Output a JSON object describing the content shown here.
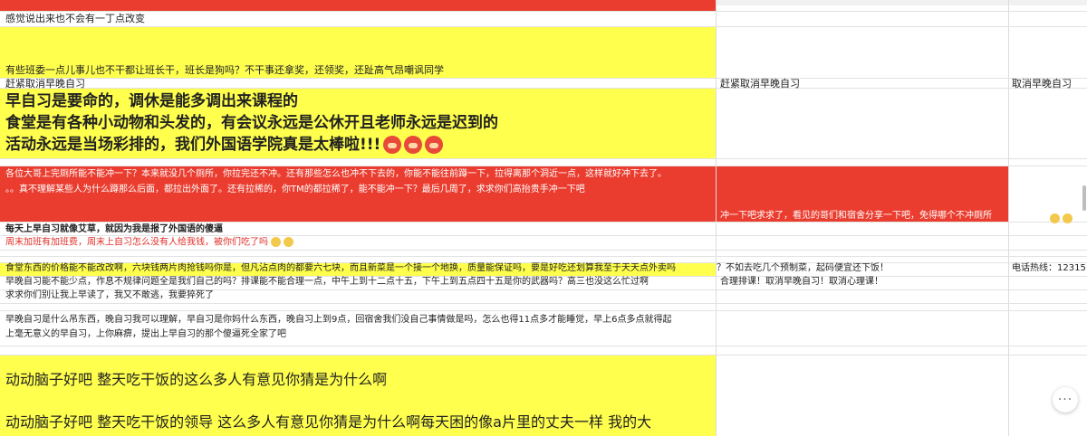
{
  "columns": {
    "col1": {},
    "col2": {},
    "col3": {}
  },
  "rows": [
    {
      "id": "r1",
      "c1": "感觉说出来也不会有一丁点改变"
    },
    {
      "id": "r2",
      "c1": "有些班委一点儿事儿也不干都让班长干，班长是狗吗？不干事还拿奖，还领奖，还趾高气昂嘲讽同学"
    },
    {
      "id": "r3",
      "c1": "赶紧取消早晚自习",
      "c2": "赶紧取消早晚自习",
      "c3": "取消早晚自习"
    },
    {
      "id": "r4",
      "lines": [
        "早自习是要命的，调休是能多调出来课程的",
        "食堂是有各种小动物和头发的，有会议永远是公休开且老师永远是迟到的",
        "活动永远是当场彩排的，我们外国语学院真是太棒啦!!!"
      ]
    },
    {
      "id": "r5",
      "lines": [
        "各位大哥上完厕所能不能冲一下？本来就没几个厕所，你拉完还不冲。还有那些怎么也冲不下去的，你能不能往前蹲一下，拉得离那个洞近一点，这样就好冲下去了。",
        "。。真不理解某些人为什么蹲那么后面，都拉出外面了。还有拉稀的，你TM的都拉稀了，能不能冲一下？最后几周了，求求你们高抬贵手冲一下吧"
      ],
      "c2": "冲一下吧求求了，看见的哥们和宿舍分享一下吧，免得哪个不冲厕所"
    },
    {
      "id": "r6",
      "c1": "每天上早自习就像艾草，就因为我是报了外国语的傻逼"
    },
    {
      "id": "r7",
      "c1": "周末加班有加班费，周末上自习怎么没有人给我钱，被你们吃了吗"
    },
    {
      "id": "r8",
      "c1": "食堂东西的价格能不能改改啊，六块钱两片肉抢钱吗你是，但凡沾点肉的都要六七块，而且新菜是一个接一个地换，质量能保证吗，要是好吃还划算我至于天天点外卖吗",
      "c2": "？不如去吃几个预制菜，起码便宜还下饭！",
      "c3": "电话热线：12315"
    },
    {
      "id": "r9",
      "c1": "早晚自习能不能少点，作息不规律问题全是我们自己的吗？排课能不能合理一点，中午上到十二点十五，下午上到五点四十五是你的武器吗？高三也没这么忙过啊",
      "c2": "合理排课！取消早晚自习！取消心理课！"
    },
    {
      "id": "r10",
      "c1": "求求你们别让我上早读了，我又不敢逃，我要猝死了"
    },
    {
      "id": "r11",
      "lines": [
        "早晚自习是什么吊东西，晚自习我可以理解，早自习是你妈什么东西，晚自习上到9点，回宿舍我们没自己事情做是吗，怎么也得11点多才能睡觉，早上6点多点就得起",
        "上毫无意义的早自习，上你麻痹，提出上早自习的那个傻逼死全家了吧"
      ]
    },
    {
      "id": "r12",
      "lines": [
        "动动脑子好吧 整天吃干饭的这么多人有意见你猜是为什么啊",
        "动动脑子好吧 整天吃干饭的领导 这么多人有意见你猜是为什么啊每天困的像a片里的丈夫一样 我的大"
      ]
    }
  ],
  "more_button": {
    "label": "···"
  },
  "colors": {
    "red": "#ea3d2f",
    "yellow": "#ffff4d",
    "grid": "#dcdcdc"
  }
}
